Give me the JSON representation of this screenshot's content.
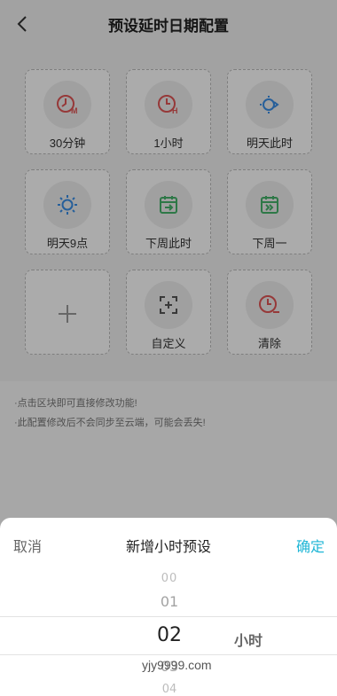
{
  "header": {
    "title": "预设延时日期配置"
  },
  "presets": [
    {
      "label": "30分钟",
      "icon": "clock-m-icon"
    },
    {
      "label": "1小时",
      "icon": "clock-h-icon"
    },
    {
      "label": "明天此时",
      "icon": "sun-arrow-icon"
    },
    {
      "label": "明天9点",
      "icon": "sun-icon"
    },
    {
      "label": "下周此时",
      "icon": "calendar-arrow-icon"
    },
    {
      "label": "下周一",
      "icon": "calendar-skip-icon"
    },
    {
      "label": "自定义",
      "icon": "custom-add-icon"
    },
    {
      "label": "清除",
      "icon": "clock-minus-icon"
    }
  ],
  "tips": [
    "·点击区块即可直接修改功能!",
    "·此配置修改后不会同步至云端，可能会丢失!"
  ],
  "sheet": {
    "cancel": "取消",
    "title": "新增小时预设",
    "confirm": "确定",
    "options": [
      "00",
      "01",
      "02",
      "03",
      "04"
    ],
    "selected": "02",
    "unit": "小时"
  },
  "watermark": "yjy9999.com",
  "colors": {
    "red": "#e05555",
    "blue": "#3a8ee6",
    "green": "#45b36b",
    "accent": "#1fb6d6"
  }
}
